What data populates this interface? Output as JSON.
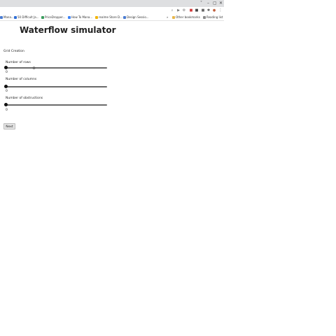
{
  "browser": {
    "window_controls": [
      "˅",
      "–",
      "▢",
      "✕"
    ],
    "toolbar_icons": [
      {
        "name": "search-icon",
        "glyph": "⌕",
        "color": "#777777"
      },
      {
        "name": "play-icon",
        "glyph": "▶",
        "color": "#777777"
      },
      {
        "name": "settings-icon",
        "glyph": "⚙",
        "color": "#777777"
      },
      {
        "name": "extension-red-icon",
        "glyph": "■",
        "color": "#d23b3b"
      },
      {
        "name": "extension-dark-icon",
        "glyph": "■",
        "color": "#444444"
      },
      {
        "name": "extension-gray-icon",
        "glyph": "■",
        "color": "#666666"
      },
      {
        "name": "puzzle-icon",
        "glyph": "✱",
        "color": "#555555"
      },
      {
        "name": "profile-avatar-icon",
        "glyph": "●",
        "color": "#c0613f"
      },
      {
        "name": "menu-icon",
        "glyph": "⋮",
        "color": "#555555"
      }
    ],
    "bookmarks": [
      {
        "label": "Mana...",
        "color": "#4a7bd1"
      },
      {
        "label": "50 Difficult Ja...",
        "color": "#2f6fd6"
      },
      {
        "label": "PriceDropper...",
        "color": "#3a9d5d"
      },
      {
        "label": "How To Mana...",
        "color": "#4285f4"
      },
      {
        "label": "realme Store D...",
        "color": "#f2b400"
      },
      {
        "label": "Design Sessio...",
        "color": "#4a7bd1"
      }
    ],
    "bookmarks_overflow": "»",
    "other_bookmarks": "Other bookmarks",
    "reading_list": "Reading list"
  },
  "page": {
    "title": "Waterflow simulator",
    "section_label": "Grid Creation",
    "fields": [
      {
        "label": "Number of rows",
        "value": "0"
      },
      {
        "label": "Number of columns",
        "value": "0"
      },
      {
        "label": "Number of obstructions",
        "value": "0"
      }
    ],
    "next_button": "Next"
  }
}
